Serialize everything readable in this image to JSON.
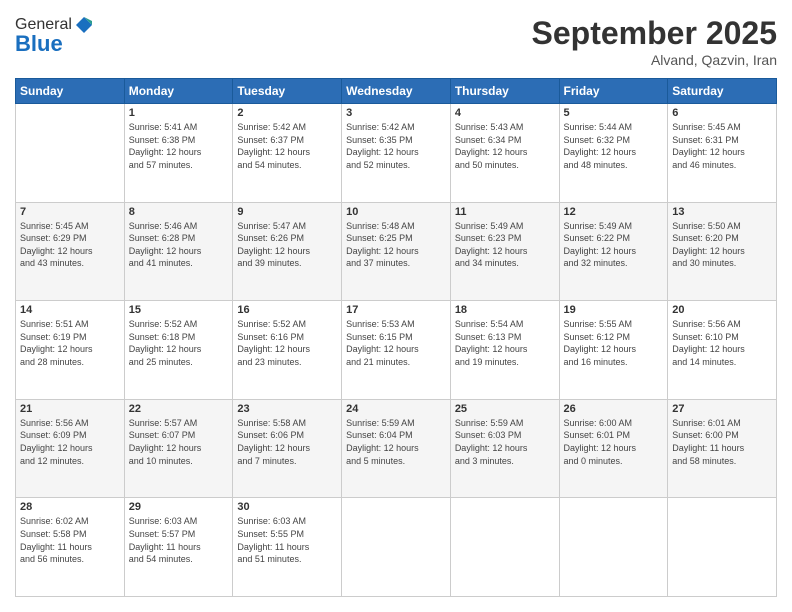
{
  "header": {
    "logo_line1": "General",
    "logo_line2": "Blue",
    "month": "September 2025",
    "location": "Alvand, Qazvin, Iran"
  },
  "days_of_week": [
    "Sunday",
    "Monday",
    "Tuesday",
    "Wednesday",
    "Thursday",
    "Friday",
    "Saturday"
  ],
  "weeks": [
    [
      {
        "day": "",
        "info": ""
      },
      {
        "day": "1",
        "info": "Sunrise: 5:41 AM\nSunset: 6:38 PM\nDaylight: 12 hours\nand 57 minutes."
      },
      {
        "day": "2",
        "info": "Sunrise: 5:42 AM\nSunset: 6:37 PM\nDaylight: 12 hours\nand 54 minutes."
      },
      {
        "day": "3",
        "info": "Sunrise: 5:42 AM\nSunset: 6:35 PM\nDaylight: 12 hours\nand 52 minutes."
      },
      {
        "day": "4",
        "info": "Sunrise: 5:43 AM\nSunset: 6:34 PM\nDaylight: 12 hours\nand 50 minutes."
      },
      {
        "day": "5",
        "info": "Sunrise: 5:44 AM\nSunset: 6:32 PM\nDaylight: 12 hours\nand 48 minutes."
      },
      {
        "day": "6",
        "info": "Sunrise: 5:45 AM\nSunset: 6:31 PM\nDaylight: 12 hours\nand 46 minutes."
      }
    ],
    [
      {
        "day": "7",
        "info": "Sunrise: 5:45 AM\nSunset: 6:29 PM\nDaylight: 12 hours\nand 43 minutes."
      },
      {
        "day": "8",
        "info": "Sunrise: 5:46 AM\nSunset: 6:28 PM\nDaylight: 12 hours\nand 41 minutes."
      },
      {
        "day": "9",
        "info": "Sunrise: 5:47 AM\nSunset: 6:26 PM\nDaylight: 12 hours\nand 39 minutes."
      },
      {
        "day": "10",
        "info": "Sunrise: 5:48 AM\nSunset: 6:25 PM\nDaylight: 12 hours\nand 37 minutes."
      },
      {
        "day": "11",
        "info": "Sunrise: 5:49 AM\nSunset: 6:23 PM\nDaylight: 12 hours\nand 34 minutes."
      },
      {
        "day": "12",
        "info": "Sunrise: 5:49 AM\nSunset: 6:22 PM\nDaylight: 12 hours\nand 32 minutes."
      },
      {
        "day": "13",
        "info": "Sunrise: 5:50 AM\nSunset: 6:20 PM\nDaylight: 12 hours\nand 30 minutes."
      }
    ],
    [
      {
        "day": "14",
        "info": "Sunrise: 5:51 AM\nSunset: 6:19 PM\nDaylight: 12 hours\nand 28 minutes."
      },
      {
        "day": "15",
        "info": "Sunrise: 5:52 AM\nSunset: 6:18 PM\nDaylight: 12 hours\nand 25 minutes."
      },
      {
        "day": "16",
        "info": "Sunrise: 5:52 AM\nSunset: 6:16 PM\nDaylight: 12 hours\nand 23 minutes."
      },
      {
        "day": "17",
        "info": "Sunrise: 5:53 AM\nSunset: 6:15 PM\nDaylight: 12 hours\nand 21 minutes."
      },
      {
        "day": "18",
        "info": "Sunrise: 5:54 AM\nSunset: 6:13 PM\nDaylight: 12 hours\nand 19 minutes."
      },
      {
        "day": "19",
        "info": "Sunrise: 5:55 AM\nSunset: 6:12 PM\nDaylight: 12 hours\nand 16 minutes."
      },
      {
        "day": "20",
        "info": "Sunrise: 5:56 AM\nSunset: 6:10 PM\nDaylight: 12 hours\nand 14 minutes."
      }
    ],
    [
      {
        "day": "21",
        "info": "Sunrise: 5:56 AM\nSunset: 6:09 PM\nDaylight: 12 hours\nand 12 minutes."
      },
      {
        "day": "22",
        "info": "Sunrise: 5:57 AM\nSunset: 6:07 PM\nDaylight: 12 hours\nand 10 minutes."
      },
      {
        "day": "23",
        "info": "Sunrise: 5:58 AM\nSunset: 6:06 PM\nDaylight: 12 hours\nand 7 minutes."
      },
      {
        "day": "24",
        "info": "Sunrise: 5:59 AM\nSunset: 6:04 PM\nDaylight: 12 hours\nand 5 minutes."
      },
      {
        "day": "25",
        "info": "Sunrise: 5:59 AM\nSunset: 6:03 PM\nDaylight: 12 hours\nand 3 minutes."
      },
      {
        "day": "26",
        "info": "Sunrise: 6:00 AM\nSunset: 6:01 PM\nDaylight: 12 hours\nand 0 minutes."
      },
      {
        "day": "27",
        "info": "Sunrise: 6:01 AM\nSunset: 6:00 PM\nDaylight: 11 hours\nand 58 minutes."
      }
    ],
    [
      {
        "day": "28",
        "info": "Sunrise: 6:02 AM\nSunset: 5:58 PM\nDaylight: 11 hours\nand 56 minutes."
      },
      {
        "day": "29",
        "info": "Sunrise: 6:03 AM\nSunset: 5:57 PM\nDaylight: 11 hours\nand 54 minutes."
      },
      {
        "day": "30",
        "info": "Sunrise: 6:03 AM\nSunset: 5:55 PM\nDaylight: 11 hours\nand 51 minutes."
      },
      {
        "day": "",
        "info": ""
      },
      {
        "day": "",
        "info": ""
      },
      {
        "day": "",
        "info": ""
      },
      {
        "day": "",
        "info": ""
      }
    ]
  ]
}
